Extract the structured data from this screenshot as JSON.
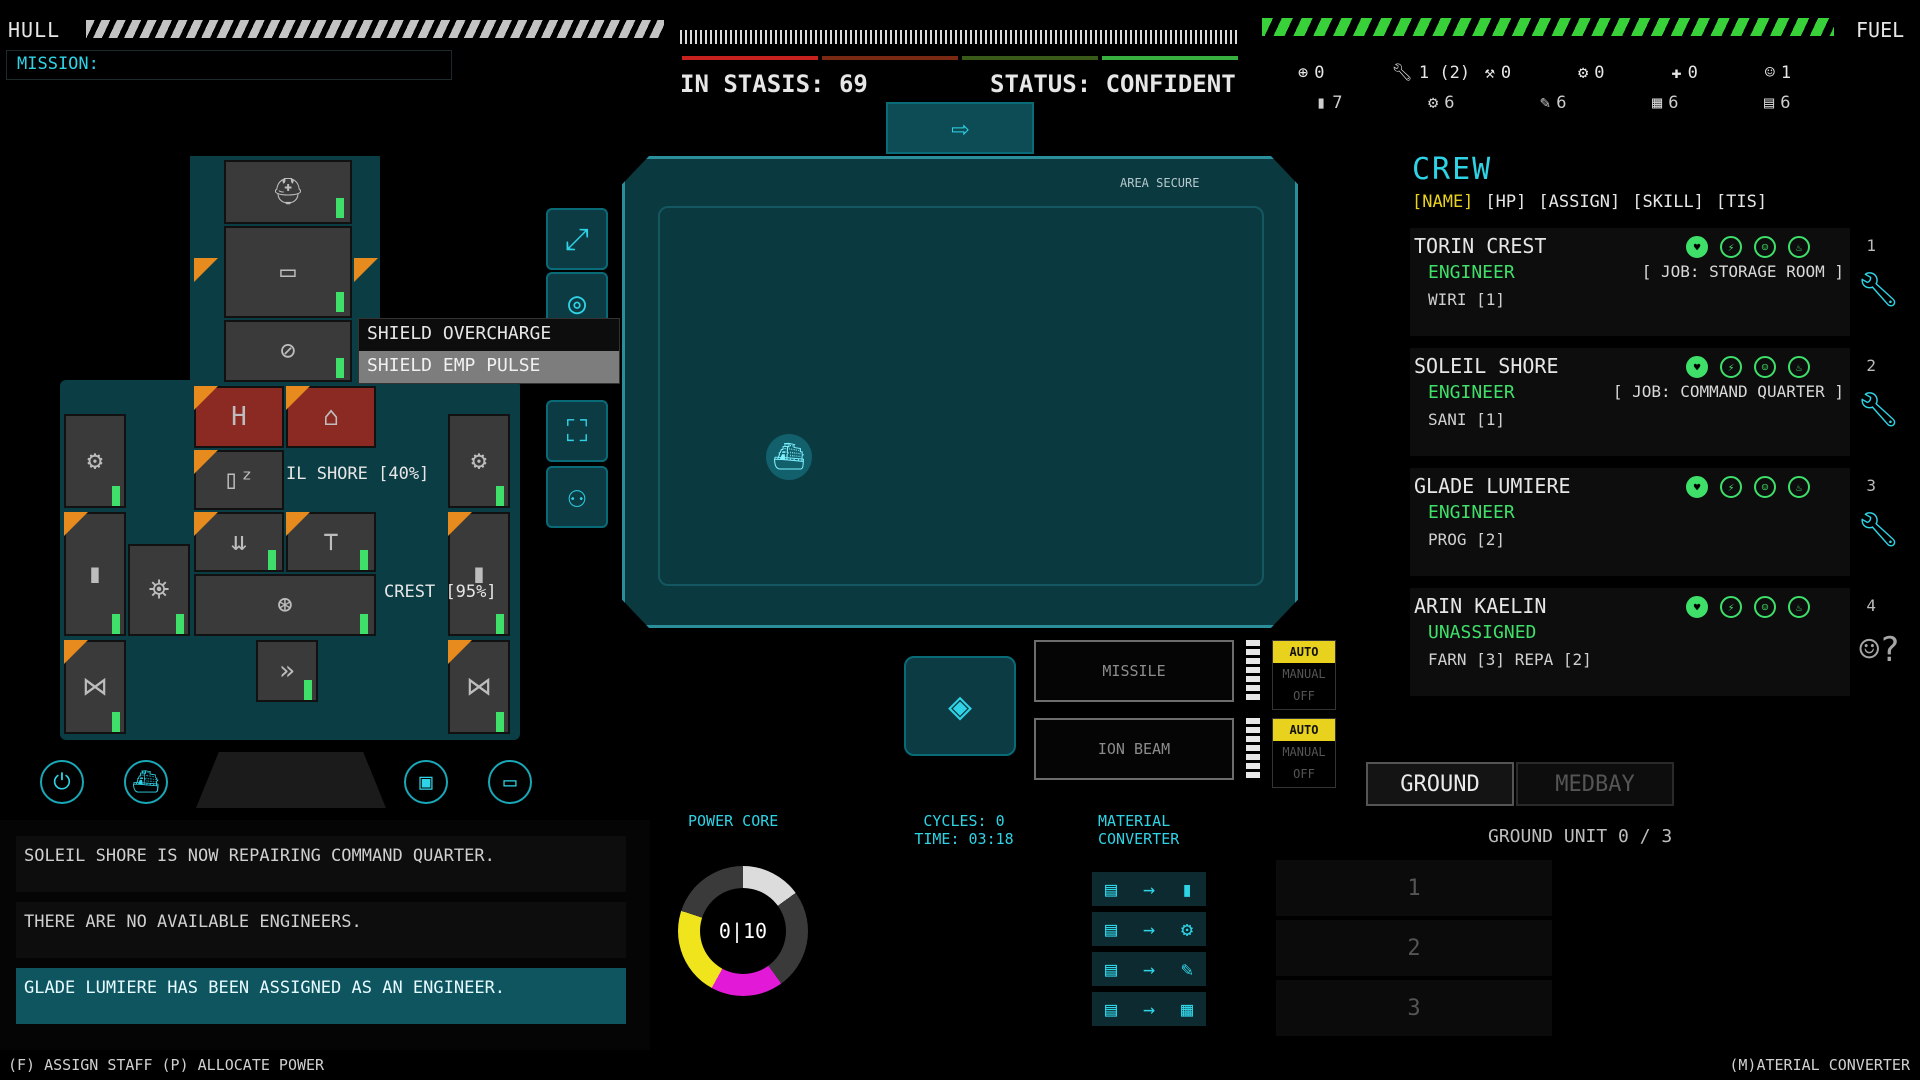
{
  "top": {
    "hull_label": "HULL",
    "fuel_label": "FUEL",
    "mission_label": "MISSION:",
    "in_stasis": "IN STASIS: 69",
    "status": "STATUS: CONFIDENT"
  },
  "resources": {
    "row1": [
      {
        "icon": "gear-clock-icon",
        "value": "0"
      },
      {
        "icon": "wrench-icon",
        "value": "1 (2)"
      },
      {
        "icon": "pickaxe-icon",
        "value": "0"
      },
      {
        "icon": "tools-icon",
        "value": "0"
      },
      {
        "icon": "drill-icon",
        "value": "0"
      },
      {
        "icon": "crew-icon",
        "value": "1"
      }
    ],
    "row2": [
      {
        "icon": "bars-icon",
        "value": "7"
      },
      {
        "icon": "gear-icon",
        "value": "6"
      },
      {
        "icon": "pen-icon",
        "value": "6"
      },
      {
        "icon": "blocks-icon",
        "value": "6"
      },
      {
        "icon": "stack-icon",
        "value": "6"
      }
    ]
  },
  "ship_menu": {
    "items": [
      "SHIELD OVERCHARGE",
      "SHIELD EMP PULSE"
    ]
  },
  "ship_labels": {
    "shore_tag": "IL SHORE [40%]",
    "crest_tag": "CREST [95%]"
  },
  "map": {
    "area_label": "AREA SECURE"
  },
  "weapons": {
    "slots": [
      {
        "label": "MISSILE",
        "modes": [
          "AUTO",
          "MANUAL",
          "OFF"
        ]
      },
      {
        "label": "ION BEAM",
        "modes": [
          "AUTO",
          "MANUAL",
          "OFF"
        ]
      }
    ]
  },
  "crew": {
    "title": "CREW",
    "headers": [
      "[NAME]",
      "[HP]",
      "[ASSIGN]",
      "[SKILL]",
      "[TIS]"
    ],
    "members": [
      {
        "name": "TORIN CREST",
        "role": "ENGINEER",
        "job": "[ JOB: STORAGE ROOM ]",
        "skill": "WIRI [1]",
        "num": "1"
      },
      {
        "name": "SOLEIL SHORE",
        "role": "ENGINEER",
        "job": "[ JOB: COMMAND QUARTER ]",
        "skill": "SANI [1]",
        "num": "2"
      },
      {
        "name": "GLADE LUMIERE",
        "role": "ENGINEER",
        "job": "",
        "skill": "PROG [2]",
        "num": "3"
      },
      {
        "name": "ARIN KAELIN",
        "role": "UNASSIGNED",
        "job": "",
        "skill": "FARN [3]   REPA [2]",
        "num": "4"
      }
    ]
  },
  "tabs": {
    "ground": "GROUND",
    "medbay": "MEDBAY"
  },
  "ground": {
    "title": "GROUND UNIT 0 / 3",
    "slots": [
      "1",
      "2",
      "3"
    ]
  },
  "log": [
    "SOLEIL SHORE IS NOW REPAIRING COMMAND QUARTER.",
    "THERE ARE NO AVAILABLE ENGINEERS.",
    "GLADE LUMIERE HAS BEEN ASSIGNED AS AN ENGINEER."
  ],
  "core": {
    "title": "POWER CORE",
    "value": "0|10",
    "cycles": "CYCLES: 0",
    "time": "TIME: 03:18"
  },
  "material": {
    "title1": "MATERIAL",
    "title2": "CONVERTER"
  },
  "hints": {
    "left": "(F) ASSIGN STAFF  (P) ALLOCATE POWER",
    "right": "(M)ATERIAL CONVERTER"
  },
  "colors": {
    "accent": "#2fd3e6",
    "good": "#3ee06a",
    "warning": "#e88b1f",
    "core_magenta": "#e21ad7",
    "core_yellow": "#f0e51c"
  }
}
